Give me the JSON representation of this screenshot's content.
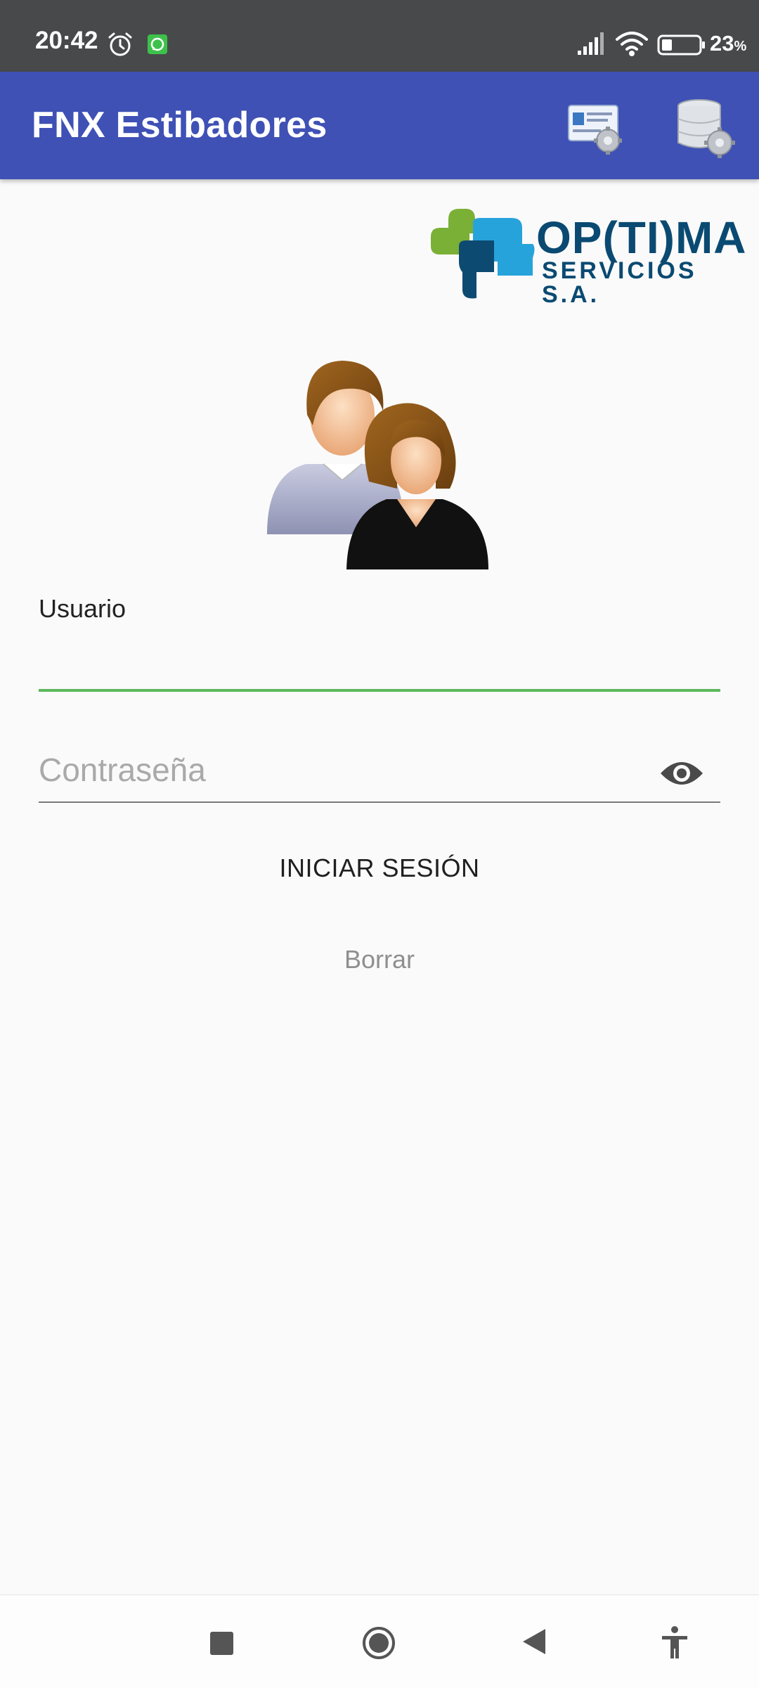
{
  "status_bar": {
    "time": "20:42",
    "battery_level": "23",
    "battery_unit": "%",
    "icons": [
      "alarm-icon",
      "whatsapp-icon",
      "signal-icon",
      "wifi-icon",
      "battery-icon"
    ]
  },
  "app_bar": {
    "title": "FNX Estibadores",
    "actions": [
      "id-card-settings-icon",
      "database-settings-icon"
    ],
    "color": "#3f51b5"
  },
  "logo": {
    "title": "OP(TI)MA",
    "subtitle": "SERVICIOS S.A."
  },
  "form": {
    "username_label": "Usuario",
    "username_value": "",
    "password_placeholder": "Contraseña",
    "password_value": "",
    "login_label": "INICIAR SESIÓN",
    "clear_label": "Borrar",
    "focus_color": "#5cb85c"
  },
  "nav_bar": {
    "icons": [
      "recents-icon",
      "home-icon",
      "back-icon",
      "accessibility-icon"
    ]
  }
}
